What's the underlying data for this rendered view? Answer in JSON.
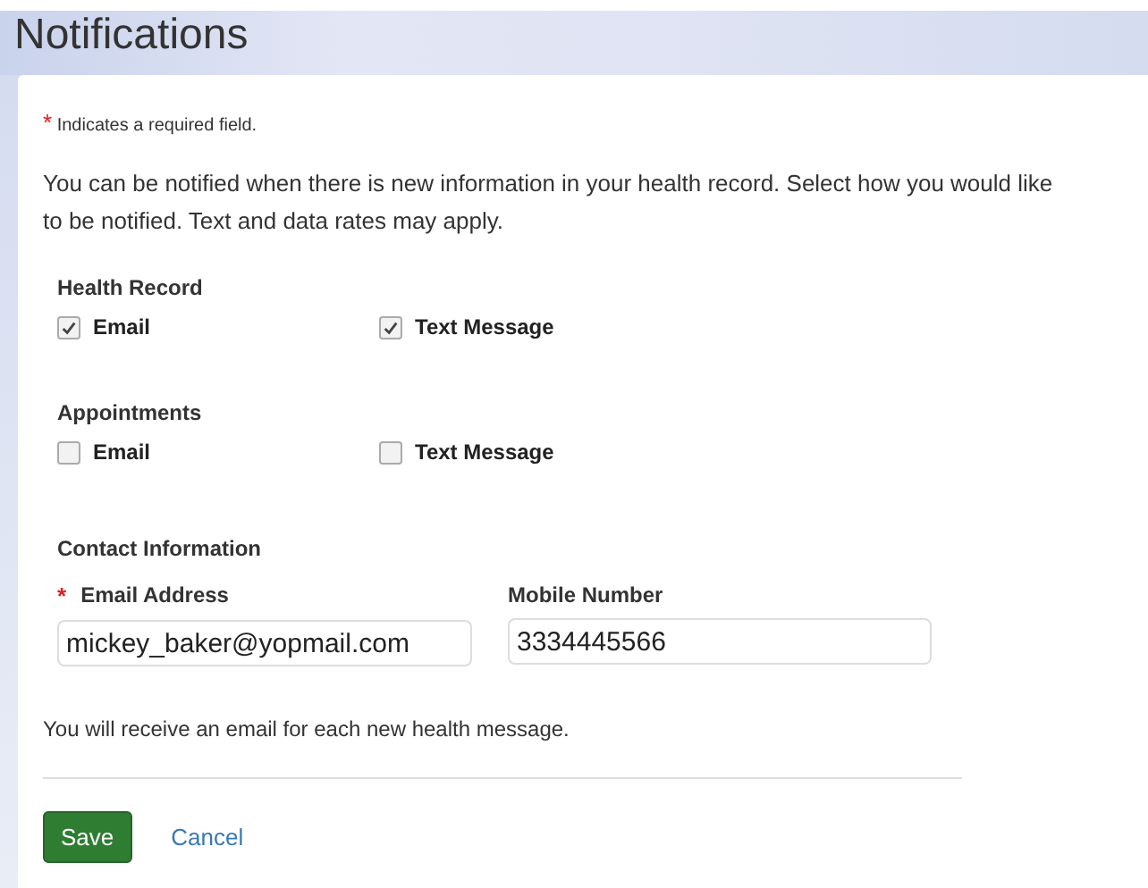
{
  "title": "Notifications",
  "required_note": {
    "mark": "*",
    "text": "Indicates a required field."
  },
  "intro": "You can be notified when there is new information in your health record.  Select how you would like to be notified. Text and data rates may apply.",
  "groups": [
    {
      "heading": "Health Record",
      "options": [
        {
          "label": "Email",
          "checked": true
        },
        {
          "label": "Text Message",
          "checked": true
        }
      ]
    },
    {
      "heading": "Appointments",
      "options": [
        {
          "label": "Email",
          "checked": false
        },
        {
          "label": "Text Message",
          "checked": false
        }
      ]
    }
  ],
  "contact": {
    "heading": "Contact Information",
    "fields": [
      {
        "label": "Email Address",
        "required": true,
        "value": "mickey_baker@yopmail.com"
      },
      {
        "label": "Mobile Number",
        "required": false,
        "value": "3334445566"
      }
    ]
  },
  "info": "You will receive an email for each new health message.",
  "buttons": [
    {
      "kind": "primary",
      "label": "Save"
    },
    {
      "kind": "link",
      "label": "Cancel"
    }
  ]
}
